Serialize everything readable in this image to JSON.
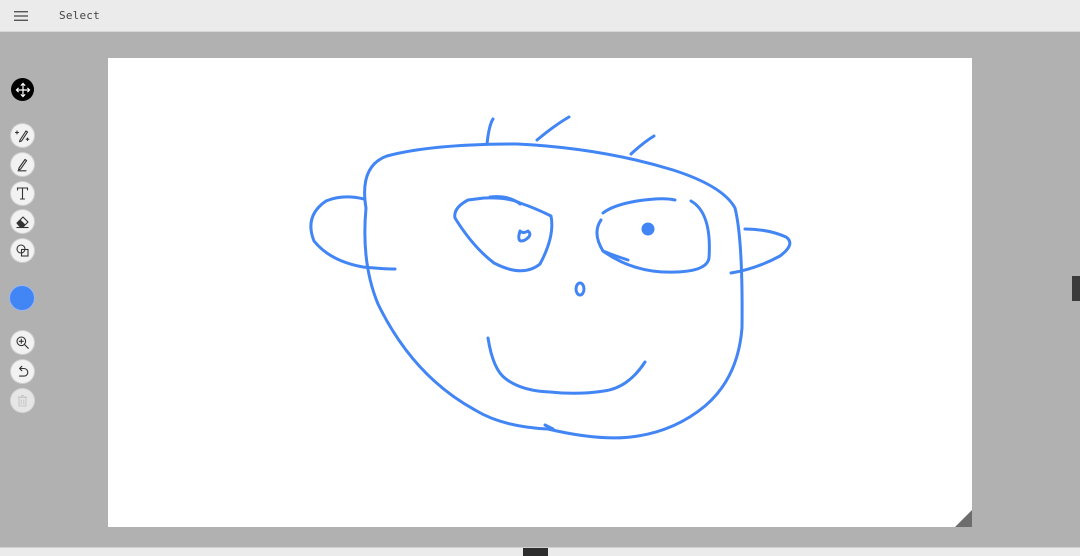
{
  "header": {
    "mode_label": "Select",
    "menu_icon": "hamburger-menu-icon"
  },
  "toolbar": {
    "tools": [
      {
        "id": "move",
        "icon": "move-arrows-icon",
        "active": true
      },
      {
        "id": "smart-pen",
        "icon": "sparkle-pen-icon"
      },
      {
        "id": "pen",
        "icon": "pen-icon"
      },
      {
        "id": "text",
        "icon": "text-icon"
      },
      {
        "id": "eraser",
        "icon": "eraser-icon"
      },
      {
        "id": "shapes",
        "icon": "shapes-icon"
      },
      {
        "id": "zoom",
        "icon": "zoom-in-icon"
      },
      {
        "id": "undo",
        "icon": "undo-icon"
      },
      {
        "id": "delete",
        "icon": "trash-icon",
        "disabled": true
      }
    ],
    "selected_color": "#4285f4"
  },
  "canvas": {
    "background": "#ffffff",
    "stroke_color": "#4285f4",
    "drawing": "smiley-face-doodle"
  },
  "colors": {
    "workspace": "#b1b1b1",
    "toolbar_bg": "#ebebeb"
  }
}
